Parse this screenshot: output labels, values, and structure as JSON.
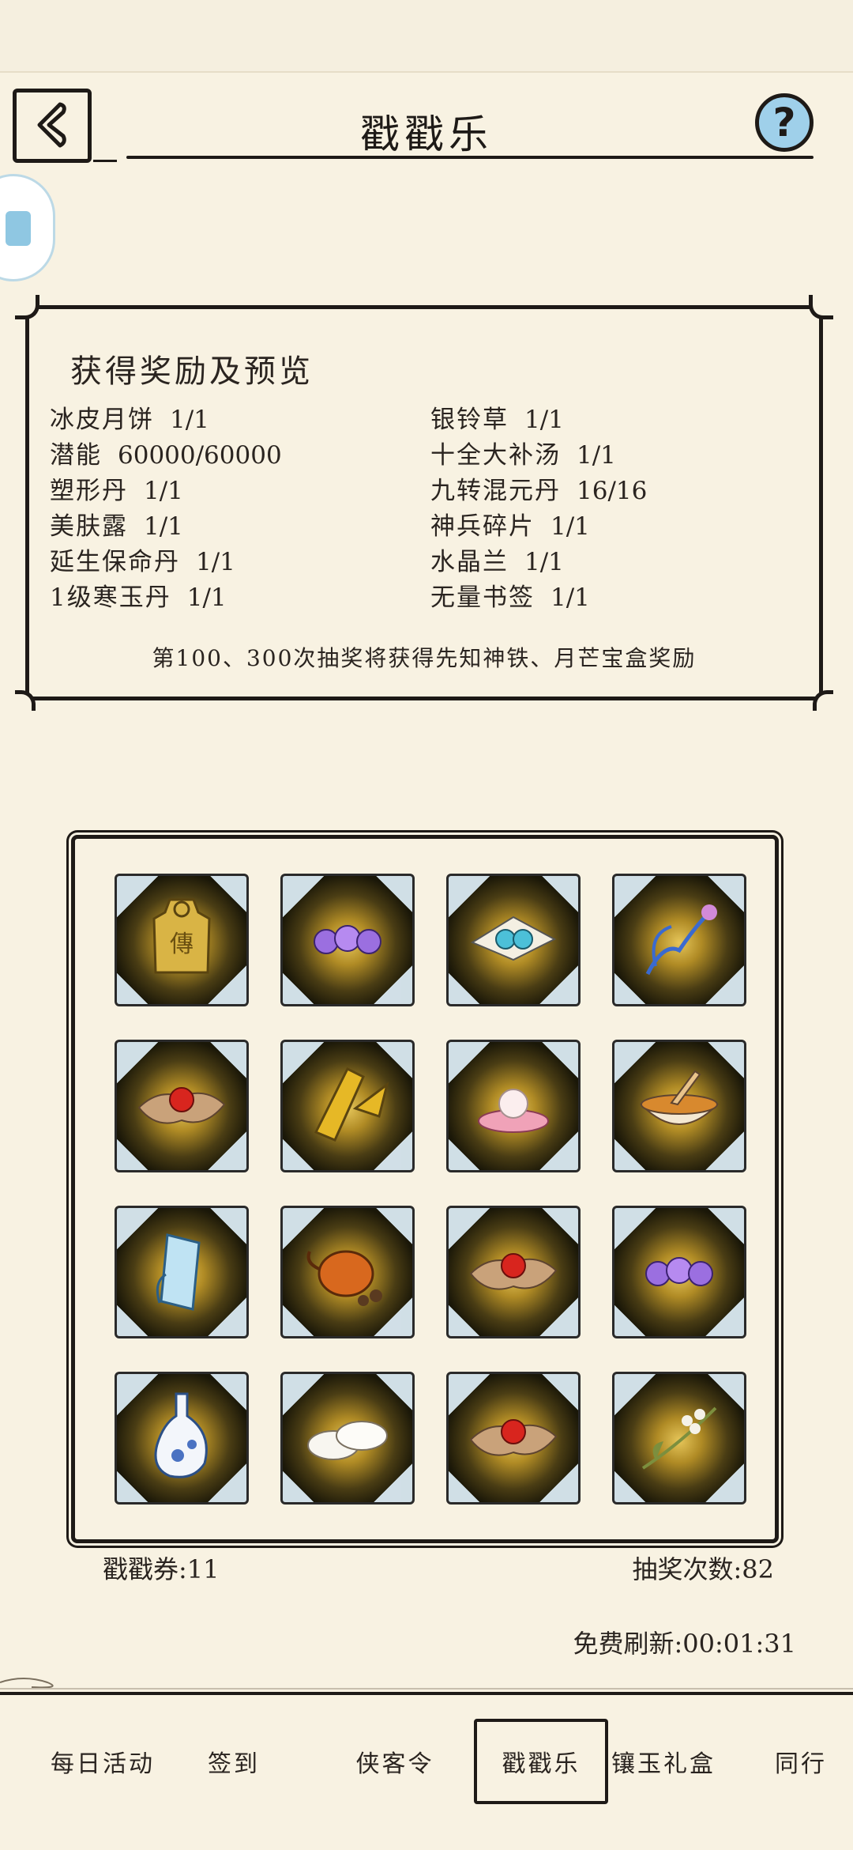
{
  "header": {
    "title": "戳戳乐",
    "back_icon": "back-chevron-icon",
    "help_icon": "question-mark-icon",
    "help_glyph": "?"
  },
  "reward_panel": {
    "title": "获得奖励及预览",
    "left_items": [
      {
        "name": "冰皮月饼",
        "count": "1/1"
      },
      {
        "name": "潜能",
        "count": "60000/60000"
      },
      {
        "name": "塑形丹",
        "count": "1/1"
      },
      {
        "name": "美肤露",
        "count": "1/1"
      },
      {
        "name": "延生保命丹",
        "count": "1/1"
      },
      {
        "name": "1级寒玉丹",
        "count": "1/1"
      }
    ],
    "right_items": [
      {
        "name": "银铃草",
        "count": "1/1"
      },
      {
        "name": "十全大补汤",
        "count": "1/1"
      },
      {
        "name": "九转混元丹",
        "count": "16/16"
      },
      {
        "name": "神兵碎片",
        "count": "1/1"
      },
      {
        "name": "水晶兰",
        "count": "1/1"
      },
      {
        "name": "无量书签",
        "count": "1/1"
      }
    ],
    "note": "第100、300次抽奖将获得先知神铁、月芒宝盒奖励"
  },
  "grid": {
    "tiles": [
      {
        "icon": "golden-token-icon"
      },
      {
        "icon": "purple-beads-icon"
      },
      {
        "icon": "blue-pills-on-paper-icon"
      },
      {
        "icon": "blue-orchid-icon"
      },
      {
        "icon": "red-pill-on-paper-icon"
      },
      {
        "icon": "weapon-fragment-icon"
      },
      {
        "icon": "pearl-shell-icon"
      },
      {
        "icon": "soup-bowl-icon"
      },
      {
        "icon": "blue-bookmark-icon"
      },
      {
        "icon": "orange-teapot-icon"
      },
      {
        "icon": "red-pill-on-paper-icon"
      },
      {
        "icon": "purple-beads-icon"
      },
      {
        "icon": "porcelain-bottle-icon"
      },
      {
        "icon": "white-mooncakes-icon"
      },
      {
        "icon": "red-pill-on-paper-icon"
      },
      {
        "icon": "silver-bell-herb-icon"
      }
    ]
  },
  "counters": {
    "tickets_label": "戳戳券:",
    "tickets_value": "11",
    "draws_label": "抽奖次数:",
    "draws_value": "82",
    "free_refresh_label": "免费刷新:",
    "free_refresh_value": "00:01:31"
  },
  "bottom_tabs": [
    {
      "label": "每日活动",
      "active": false
    },
    {
      "label": "签到",
      "active": false
    },
    {
      "label": "侠客令",
      "active": false
    },
    {
      "label": "戳戳乐",
      "active": true
    },
    {
      "label": "镶玉礼盒",
      "active": false
    },
    {
      "label": "同行",
      "active": false
    }
  ],
  "colors": {
    "background": "#f8f2e2",
    "ink": "#1e1a17",
    "help_blue": "#9fd0ea",
    "tile_glow": "#e6c65a"
  }
}
